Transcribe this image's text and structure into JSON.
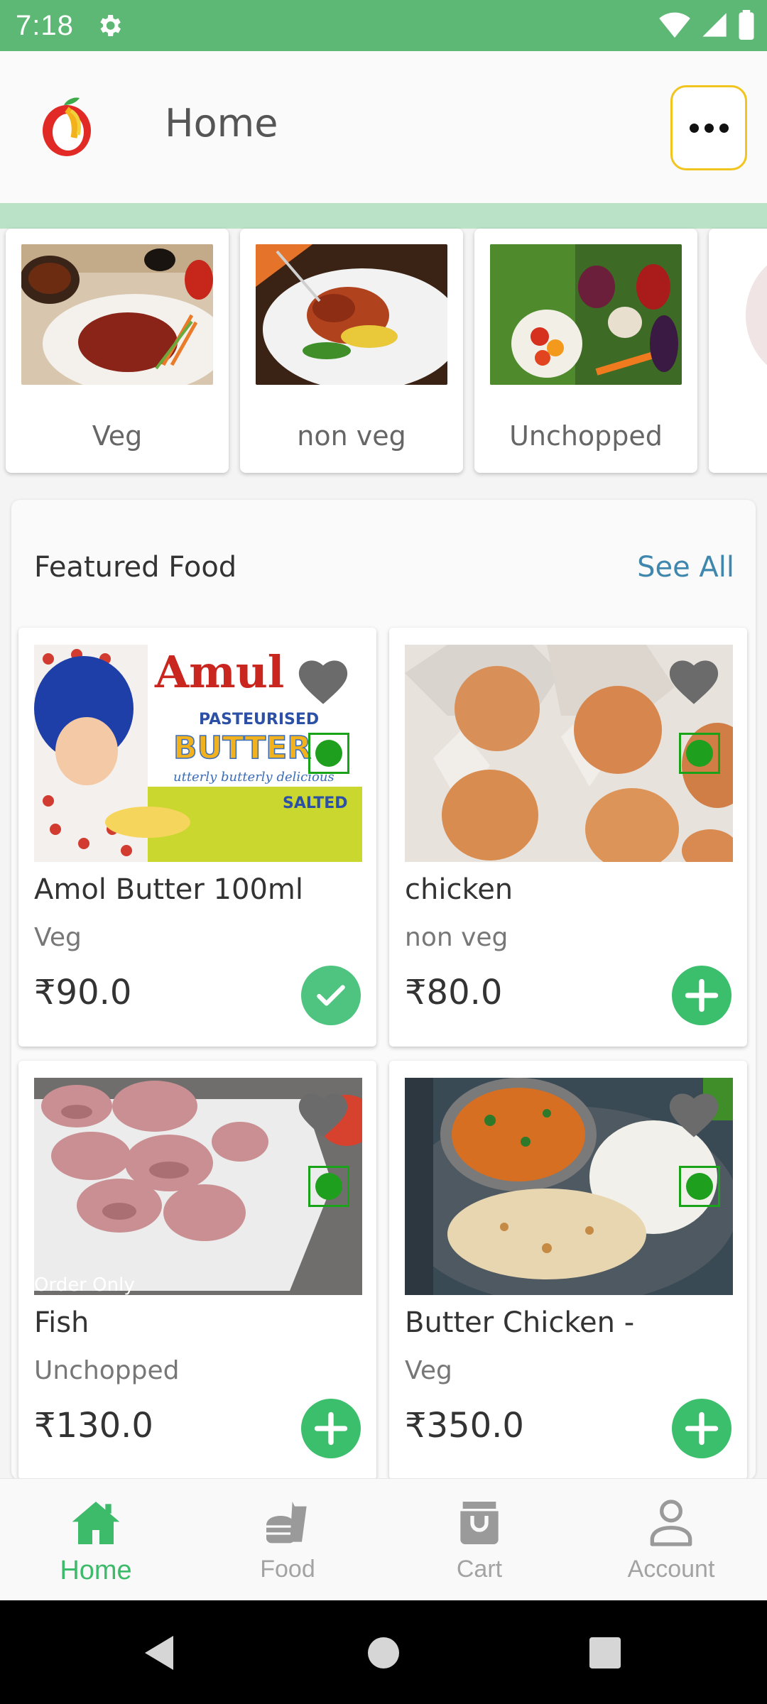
{
  "status_bar": {
    "time": "7:18"
  },
  "app_bar": {
    "title": "Home"
  },
  "categories": [
    {
      "label": "Veg",
      "image": "veg-dish-photo"
    },
    {
      "label": "non veg",
      "image": "roast-chicken-photo"
    },
    {
      "label": "Unchopped",
      "image": "vegetables-photo"
    },
    {
      "label": "",
      "image": "partial-card-photo"
    }
  ],
  "featured": {
    "title": "Featured Food",
    "see_all": "See All",
    "items": [
      {
        "name": "Amol Butter 100ml",
        "category": "Veg",
        "price": "₹90.0",
        "added": true,
        "image": "butter-pack-photo"
      },
      {
        "name": "chicken",
        "category": "non veg",
        "price": "₹80.0",
        "added": false,
        "image": "eggs-photo"
      },
      {
        "name": "Fish",
        "category": "Unchopped",
        "price": "₹130.0",
        "added": false,
        "image": "fish-pieces-photo"
      },
      {
        "name": "Butter Chicken -",
        "category": "Veg",
        "price": "₹350.0",
        "added": false,
        "image": "butter-chicken-photo"
      }
    ],
    "image_text": {
      "brand": "Amul",
      "line1": "PASTEURISED",
      "line2": "BUTTER",
      "line3": "utterly butterly delicious",
      "line4": "SALTED",
      "fish_caption": "Order Only"
    }
  },
  "bottom_nav": [
    {
      "label": "Home",
      "icon": "home-icon",
      "active": true
    },
    {
      "label": "Food",
      "icon": "food-icon",
      "active": false
    },
    {
      "label": "Cart",
      "icon": "cart-icon",
      "active": false
    },
    {
      "label": "Account",
      "icon": "account-icon",
      "active": false
    }
  ],
  "colors": {
    "status_bar": "#5cb874",
    "accent_green": "#3cbf6c",
    "link_blue": "#3f87ad",
    "menu_border": "#f2c41e"
  }
}
